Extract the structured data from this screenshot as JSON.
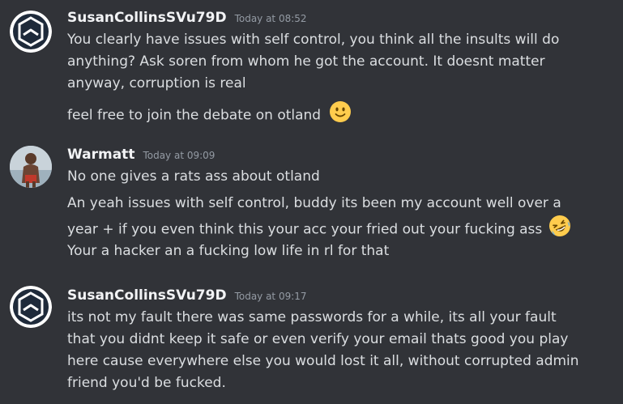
{
  "messages": [
    {
      "username": "SusanCollinsSVu79D",
      "timestamp": "Today at 08:52",
      "avatar_icon": "hexagon-logo-icon",
      "lines": [
        "You clearly have issues with self control, you think all the insults will do",
        "anything? Ask soren from whom he got the account. It doesnt matter",
        "anyway, corruption is real",
        "feel free to join the debate on otland"
      ],
      "emoji": "slightly-smiling-face-icon"
    },
    {
      "username": "Warmatt",
      "timestamp": "Today at 09:09",
      "avatar_icon": "profile-photo",
      "lines": [
        "No one gives a rats ass about otland",
        "An yeah issues with self control, buddy its been my account well over a",
        "year + if you even think this your acc your fried out your fucking ass",
        "Your a hacker an a fucking low life in rl for that"
      ],
      "emoji": "rolling-on-floor-laughing-icon"
    },
    {
      "username": "SusanCollinsSVu79D",
      "timestamp": "Today at 09:17",
      "avatar_icon": "hexagon-logo-icon",
      "lines": [
        "its not my fault there was same passwords for a while, its all your fault",
        "that you didnt keep it safe or even verify your email thats good you play",
        "here cause everywhere else you would lost it all, without corrupted admin",
        "friend you'd be fucked."
      ]
    }
  ]
}
